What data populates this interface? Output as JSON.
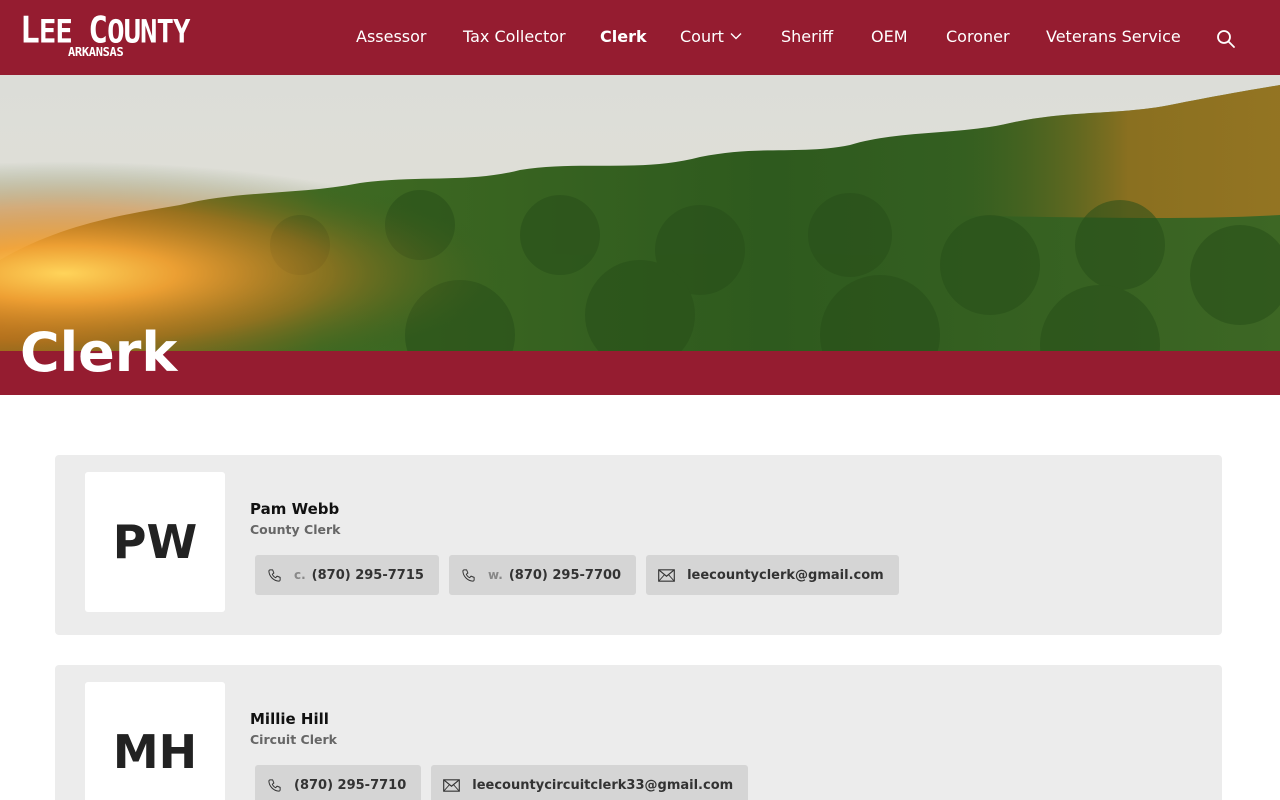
{
  "site": {
    "logo_main": "Lee County",
    "logo_sub": "ARKANSAS"
  },
  "nav": {
    "items": [
      {
        "label": "Assessor"
      },
      {
        "label": "Tax Collector"
      },
      {
        "label": "Clerk"
      },
      {
        "label": "Court"
      },
      {
        "label": "Sheriff"
      },
      {
        "label": "OEM"
      },
      {
        "label": "Coroner"
      },
      {
        "label": "Veterans Service"
      }
    ],
    "active": "Clerk",
    "search_icon": "search-icon"
  },
  "page": {
    "title": "Clerk"
  },
  "contacts": [
    {
      "initials": "PW",
      "name": "Pam Webb",
      "title": "County Clerk",
      "phones": [
        {
          "prefix": "c.",
          "number": "(870) 295-7715"
        },
        {
          "prefix": "w.",
          "number": "(870) 295-7700"
        }
      ],
      "email": "leecountyclerk@gmail.com"
    },
    {
      "initials": "MH",
      "name": "Millie Hill",
      "title": "Circuit Clerk",
      "phones": [
        {
          "prefix": "",
          "number": "(870) 295-7710"
        }
      ],
      "email": "leecountycircuitclerk33@gmail.com"
    }
  ],
  "colors": {
    "brand": "#951c30",
    "card_bg": "#ececec",
    "pill_bg": "#d5d5d5"
  }
}
